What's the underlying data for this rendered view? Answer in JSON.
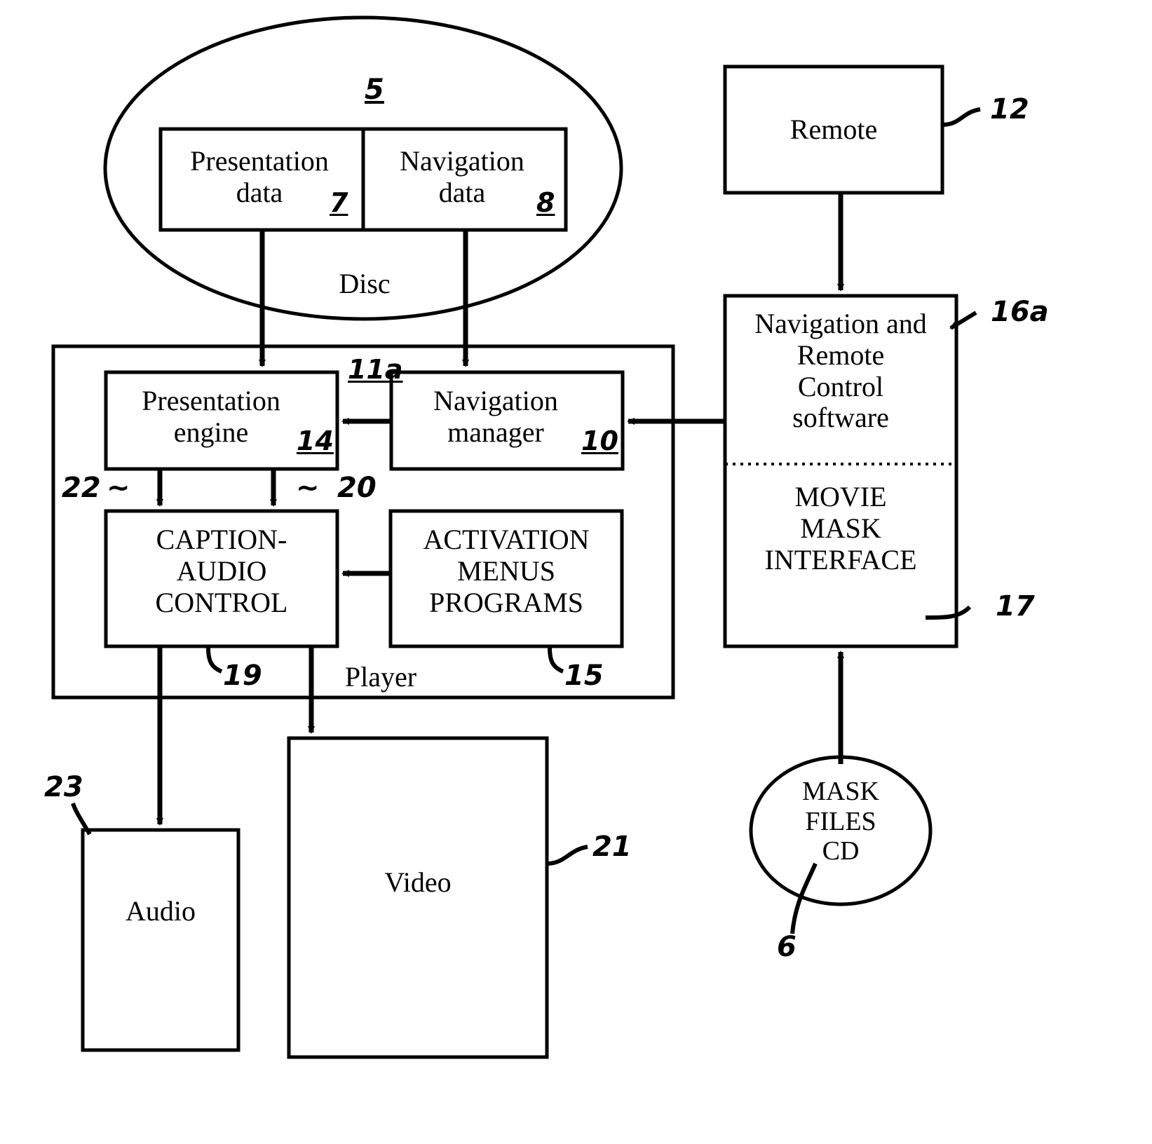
{
  "figure": {
    "title": "DVD player movie mask system block diagram",
    "line_color": "#000000",
    "background": "#ffffff"
  },
  "nodes": {
    "disc_ellipse": {
      "label": "Disc",
      "ref": "5"
    },
    "presentation_data": {
      "label": "Presentation\ndata",
      "ref": "7"
    },
    "navigation_data": {
      "label": "Navigation\ndata",
      "ref": "8"
    },
    "remote": {
      "label": "Remote",
      "ref": "12"
    },
    "nav_remote_software": {
      "label": "Navigation and\nRemote\nControl\nsoftware",
      "ref": "16a"
    },
    "movie_mask_interface": {
      "label": "MOVIE\nMASK\nINTERFACE",
      "ref": "17"
    },
    "player": {
      "label": "Player"
    },
    "presentation_engine": {
      "label": "Presentation\nengine",
      "ref": "14"
    },
    "navigation_manager": {
      "label": "Navigation\nmanager",
      "ref": "10"
    },
    "caption_audio_control": {
      "label": "CAPTION-\nAUDIO\nCONTROL",
      "ref": "19"
    },
    "activation_menus_programs": {
      "label": "ACTIVATION\nMENUS\nPROGRAMS",
      "ref": "15"
    },
    "audio": {
      "label": "Audio",
      "ref": "23"
    },
    "video": {
      "label": "Video",
      "ref": "21"
    },
    "mask_files_cd": {
      "label": "MASK\nFILES\nCD",
      "ref": "6"
    }
  },
  "connector_refs": {
    "disc_to_navigation_manager": "11a",
    "engine_to_caption_left": "22",
    "engine_to_caption_right": "20"
  },
  "tilde_marks": {
    "left": "~",
    "right": "~"
  }
}
